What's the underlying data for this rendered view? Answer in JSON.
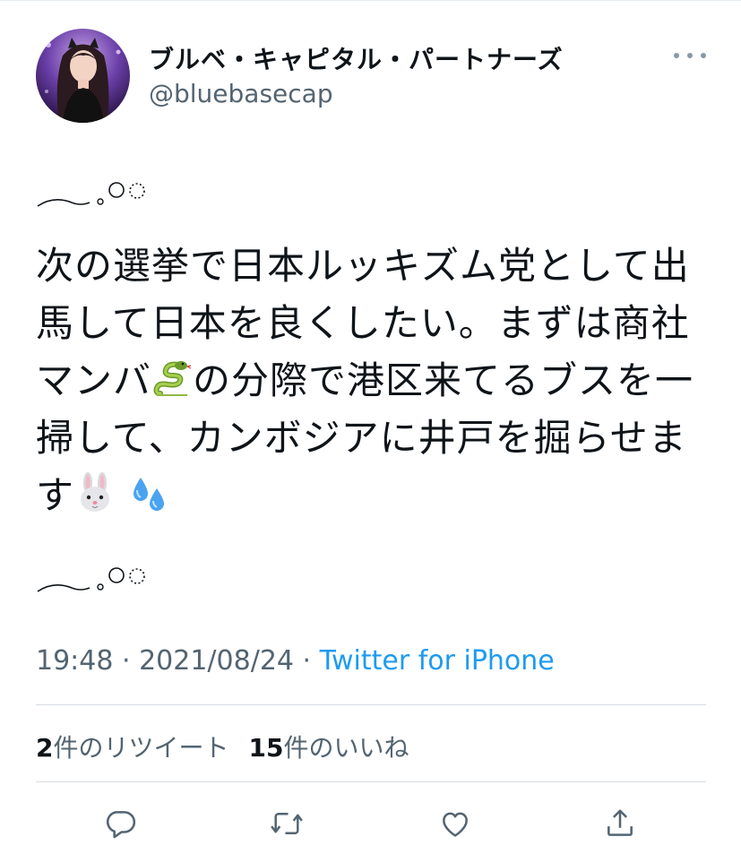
{
  "user": {
    "display_name": "ブルベ・キャピタル・パートナーズ",
    "handle": "@bluebasecap",
    "avatar_icon": "profile-avatar"
  },
  "tweet": {
    "decoration": "︵ ｡◯◌",
    "lines": [
      "次の選挙で日本ルッキズム党として出",
      "馬して日本を良くしたい。まずは商社",
      "マンバ",
      "の分際で港区来てるブスを一",
      "掃して、カンボジアに井戸を掘らせま",
      "す"
    ],
    "emojis": [
      "snake",
      "rabbit-face",
      "sweat-droplets"
    ]
  },
  "meta": {
    "time": "19:48",
    "sep1": " · ",
    "date": "2021/08/24",
    "sep2": " · ",
    "source": "Twitter for iPhone"
  },
  "stats": {
    "retweets_count": "2",
    "retweets_label": "件のリツイート",
    "likes_count": "15",
    "likes_label": "件のいいね"
  },
  "actions": [
    "reply-icon",
    "retweet-icon",
    "like-icon",
    "share-icon"
  ],
  "colors": {
    "link": "#1d9bf0",
    "secondary_text": "#536471",
    "icon": "#536471"
  }
}
